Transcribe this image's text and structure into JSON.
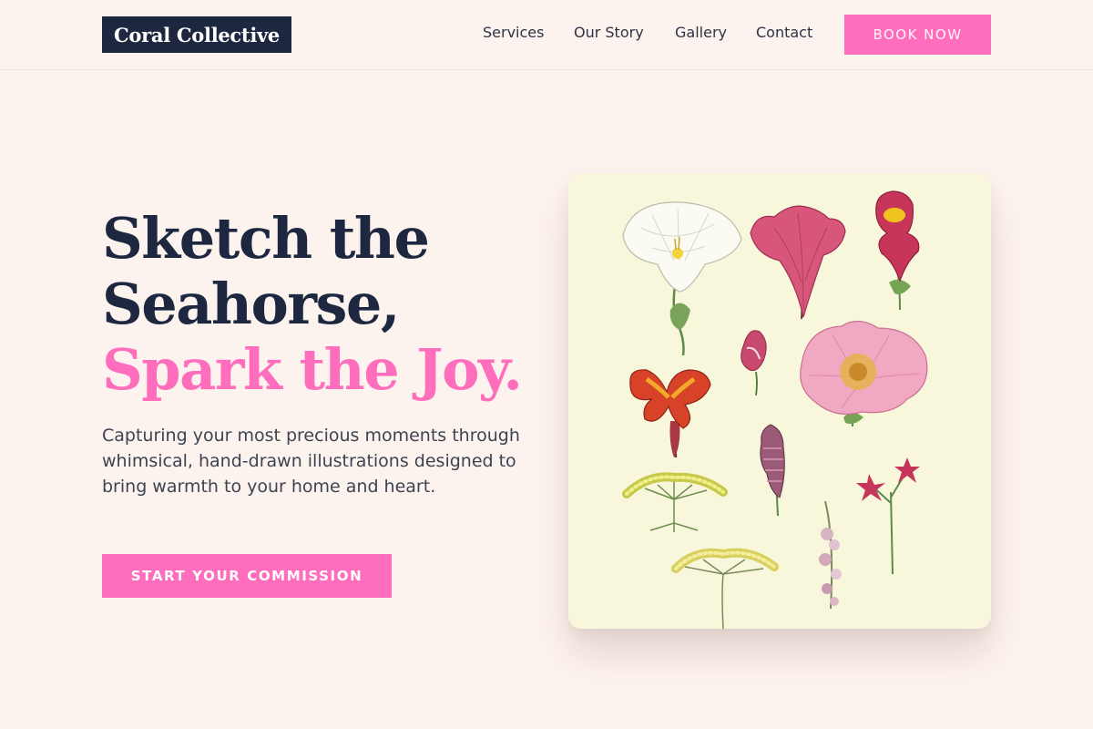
{
  "brand": {
    "name": "Coral Collective"
  },
  "nav": {
    "links": [
      "Services",
      "Our Story",
      "Gallery",
      "Contact"
    ],
    "cta_label": "BOOK NOW"
  },
  "hero": {
    "headline_line1": "Sketch the",
    "headline_line2": "Seahorse,",
    "headline_accent": "Spark the Joy.",
    "subtitle": "Capturing your most precious moments through whimsical, hand-drawn illustrations designed to bring warmth to your home and heart.",
    "cta_label": "START YOUR COMMISSION"
  },
  "illustration": {
    "subject": "botanical flower plate",
    "flowers": [
      "white-trumpet-flower",
      "pink-tulip",
      "red-snapdragon",
      "small-pink-bud",
      "pink-wild-rose",
      "red-orange-orchid",
      "purple-spike-flower",
      "yellow-umbel",
      "red-star-flowers",
      "pink-flower-spike",
      "yellow-yarrow"
    ]
  },
  "colors": {
    "background": "#fdf3ee",
    "navy": "#1d2840",
    "accent_pink": "#ff6ebc",
    "card_bg": "#f8f7dc"
  }
}
